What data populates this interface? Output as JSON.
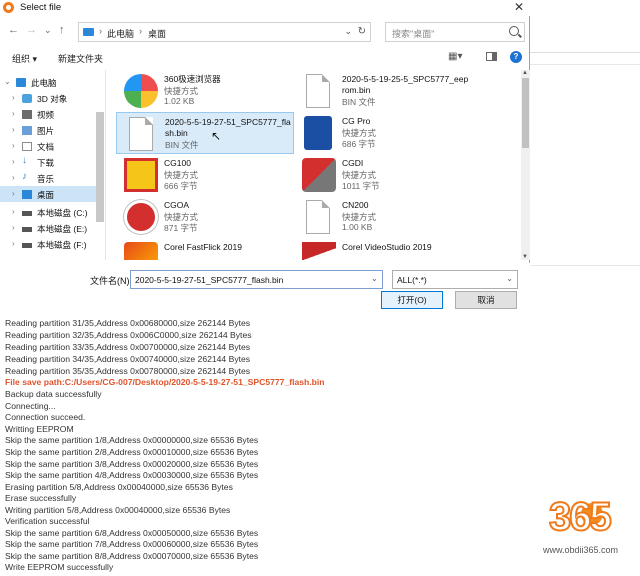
{
  "dialog": {
    "title": "Select file",
    "close_glyph": "✕",
    "nav": {
      "back": "←",
      "forward": "→",
      "up_list": "⌄",
      "up": "↑"
    },
    "breadcrumb": [
      "此电脑",
      "桌面"
    ],
    "breadcrumb_sep": "›",
    "search_placeholder": "搜索\"桌面\"",
    "toolbar": {
      "organize": "组织 ▾",
      "new_folder": "新建文件夹"
    },
    "nav_items": [
      {
        "label": "此电脑",
        "icon": "computer-icon",
        "color": "#2b88d8"
      },
      {
        "label": "3D 对象",
        "icon": "3d-objects-icon",
        "color": "#4aa3df"
      },
      {
        "label": "视频",
        "icon": "video-icon",
        "color": "#6c6c6c"
      },
      {
        "label": "图片",
        "icon": "pictures-icon",
        "color": "#6a9fd8"
      },
      {
        "label": "文档",
        "icon": "documents-icon",
        "color": "#8c8c8c"
      },
      {
        "label": "下载",
        "icon": "downloads-icon",
        "color": "#2b88d8"
      },
      {
        "label": "音乐",
        "icon": "music-icon",
        "color": "#2b88d8"
      },
      {
        "label": "桌面",
        "icon": "desktop-icon",
        "color": "#2b88d8"
      },
      {
        "label": "本地磁盘 (C:)",
        "icon": "drive-icon",
        "color": "#555555"
      },
      {
        "label": "本地磁盘 (E:)",
        "icon": "drive-icon",
        "color": "#555555"
      },
      {
        "label": "本地磁盘 (F:)",
        "icon": "drive-icon",
        "color": "#555555"
      }
    ],
    "files": [
      {
        "name": "360极速浏览器",
        "line2": "快捷方式",
        "line3": "1.02 KB",
        "icon": "360-browser-icon"
      },
      {
        "name": "2020-5-5-19-25-5_SPC5777_eeprom.bin",
        "line2": "BIN 文件",
        "line3": "",
        "icon": "bin-file-icon"
      },
      {
        "name": "2020-5-5-19-27-51_SPC5777_flash.bin",
        "line2": "BIN 文件",
        "line3": "",
        "icon": "bin-file-icon"
      },
      {
        "name": "CG Pro",
        "line2": "快捷方式",
        "line3": "686 字节",
        "icon": "cg-pro-icon"
      },
      {
        "name": "CG100",
        "line2": "快捷方式",
        "line3": "666 字节",
        "icon": "cg100-icon"
      },
      {
        "name": "CGDI",
        "line2": "快捷方式",
        "line3": "1011 字节",
        "icon": "cgdi-icon"
      },
      {
        "name": "CGOA",
        "line2": "快捷方式",
        "line3": "871 字节",
        "icon": "cgoa-icon"
      },
      {
        "name": "CN200",
        "line2": "快捷方式",
        "line3": "1.00 KB",
        "icon": "cn200-icon"
      },
      {
        "name": "Corel FastFlick 2019",
        "line2": "",
        "line3": "",
        "icon": "corel-fastflick-icon"
      },
      {
        "name": "Corel VideoStudio 2019",
        "line2": "",
        "line3": "",
        "icon": "corel-videostudio-icon"
      }
    ],
    "filename_label": "文件名(N):",
    "filename_value": "2020-5-5-19-27-51_SPC5777_flash.bin",
    "filter_value": "ALL(*.*)",
    "open_button": "打开(O)",
    "cancel_button": "取消"
  },
  "log": {
    "lines": [
      "Reading partition 31/35,Address 0x00680000,size 262144 Bytes",
      "Reading partition 32/35,Address 0x006C0000,size 262144 Bytes",
      "Reading partition 33/35,Address 0x00700000,size 262144 Bytes",
      "Reading partition 34/35,Address 0x00740000,size 262144 Bytes",
      "Reading partition 35/35,Address 0x00780000,size 262144 Bytes",
      "File save path:C:/Users/CG-007/Desktop/2020-5-5-19-27-51_SPC5777_flash.bin",
      "Backup data successfully",
      "Connecting...",
      "Connection succeed.",
      "Writting EEPROM",
      "Skip the same partition 1/8,Address 0x00000000,size 65536 Bytes",
      "Skip the same partition 2/8,Address 0x00010000,size 65536 Bytes",
      "Skip the same partition 3/8,Address 0x00020000,size 65536 Bytes",
      "Skip the same partition 4/8,Address 0x00030000,size 65536 Bytes",
      "Erasing partition 5/8,Address 0x00040000,size 65536 Bytes",
      "Erase successfully",
      "Writing partition 5/8,Address 0x00040000,size 65536 Bytes",
      "Verification successful",
      "Skip the same partition 6/8,Address 0x00050000,size 65536 Bytes",
      "Skip the same partition 7/8,Address 0x00060000,size 65536 Bytes",
      "Skip the same partition 8/8,Address 0x00070000,size 65536 Bytes",
      "Write EEPROM successfully"
    ],
    "highlight_color": "#e0532a"
  },
  "watermark": {
    "mark": "365",
    "url": "www.obdii365.com"
  }
}
